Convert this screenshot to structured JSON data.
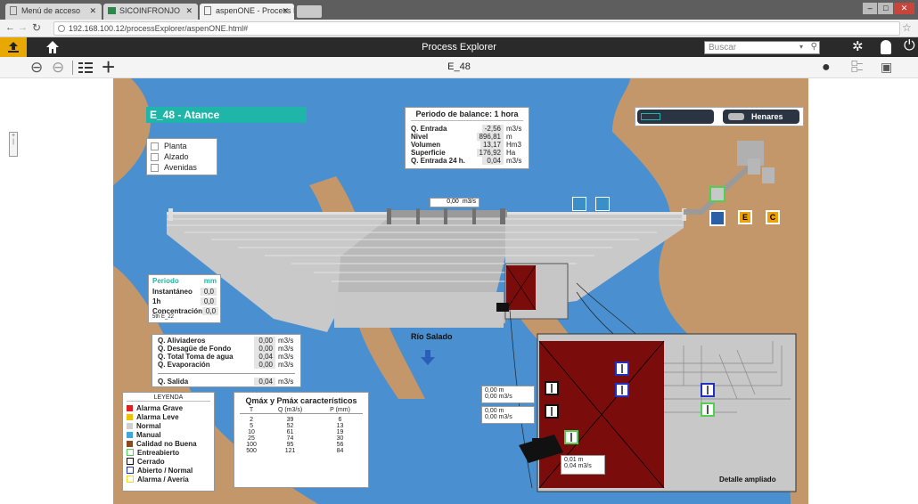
{
  "browser": {
    "tabs": [
      {
        "label": "Menú de acceso"
      },
      {
        "label": "SICOINFRONJO"
      },
      {
        "label": "aspenONE - Process Expl"
      }
    ],
    "url": "192.168.100.12/processExplorer/aspenONE.html#"
  },
  "app": {
    "title": "Process Explorer",
    "subtitle": "E_48",
    "search_placeholder": "Buscar"
  },
  "scene": {
    "title": "E_48 - Atance",
    "views": [
      "Planta",
      "Alzado",
      "Avenidas"
    ],
    "switch_label": "Henares",
    "gate_readout": {
      "value": "0,00",
      "unit": "m3/s"
    },
    "c_chips": [
      "E",
      "C"
    ],
    "river_label": "Río Salado",
    "detail_label": "Detalle ampliado"
  },
  "balance": {
    "title": "Periodo de balance: 1 hora",
    "rows": [
      {
        "label": "Q. Entrada",
        "value": "-2,56",
        "unit": "m3/s"
      },
      {
        "label": "Nivel",
        "value": "896,81",
        "unit": "m"
      },
      {
        "label": "Volumen",
        "value": "13,17",
        "unit": "Hm3"
      },
      {
        "label": "Superficie",
        "value": "176,92",
        "unit": "Ha"
      },
      {
        "label": "Q. Entrada 24 h.",
        "value": "0,04",
        "unit": "m3/s"
      }
    ]
  },
  "rain": {
    "col1": "Periodo",
    "col2": "mm",
    "rows": [
      {
        "label": "Instantáneo",
        "value": "0,0"
      },
      {
        "label": "1h",
        "value": "0,0"
      },
      {
        "label": "Concentración",
        "sub": "5th E_22",
        "value": "0,0"
      }
    ]
  },
  "flows": {
    "rows": [
      {
        "label": "Q. Aliviaderos",
        "value": "0,00",
        "unit": "m3/s"
      },
      {
        "label": "Q. Desagüe de Fondo",
        "value": "0,00",
        "unit": "m3/s"
      },
      {
        "label": "Q. Total Toma de agua",
        "value": "0,04",
        "unit": "m3/s"
      },
      {
        "label": "Q. Evaporación",
        "value": "0,00",
        "unit": "m3/s"
      }
    ],
    "exit": {
      "label": "Q. Salida",
      "value": "0,04",
      "unit": "m3/s"
    }
  },
  "legend": {
    "title": "LEYENDA",
    "items": [
      {
        "label": "Alarma Grave",
        "color": "#e02020",
        "kind": "fill"
      },
      {
        "label": "Alarma Leve",
        "color": "#f0c000",
        "kind": "fill"
      },
      {
        "label": "Normal",
        "color": "#d0d0d0",
        "kind": "fill"
      },
      {
        "label": "Manual",
        "color": "#40a8d8",
        "kind": "fill"
      },
      {
        "label": "Calidad no Buena",
        "color": "#8a4a20",
        "kind": "fill"
      },
      {
        "label": "Entreabierto",
        "color": "#50d050",
        "kind": "border"
      },
      {
        "label": "Cerrado",
        "color": "#111111",
        "kind": "border"
      },
      {
        "label": "Abierto / Normal",
        "color": "#2030c0",
        "kind": "border"
      },
      {
        "label": "Alarma / Avería",
        "color": "#f0e020",
        "kind": "border"
      }
    ]
  },
  "qmax": {
    "title": "Qmáx y Pmáx característicos",
    "headers": [
      "T",
      "Q (m3/s)",
      "P (mm)"
    ],
    "rows": [
      [
        "2",
        "39",
        "6"
      ],
      [
        "5",
        "52",
        "13"
      ],
      [
        "10",
        "61",
        "19"
      ],
      [
        "25",
        "74",
        "30"
      ],
      [
        "100",
        "95",
        "56"
      ],
      [
        "500",
        "121",
        "84"
      ]
    ]
  },
  "readouts": [
    {
      "value": "0,00",
      "unit": "m"
    },
    {
      "value": "0,00",
      "unit": "m3/s"
    },
    {
      "value": "0,00",
      "unit": "m"
    },
    {
      "value": "0,00",
      "unit": "m3/s"
    },
    {
      "value": "0,01",
      "unit": "m"
    },
    {
      "value": "0,04",
      "unit": "m3/s"
    }
  ],
  "colors": {
    "accent": "#1fb5a8",
    "water": "#4a8fcf",
    "land": "#c4976a",
    "concrete": "#c8c8c8",
    "alarm": "#7a0c0c"
  }
}
